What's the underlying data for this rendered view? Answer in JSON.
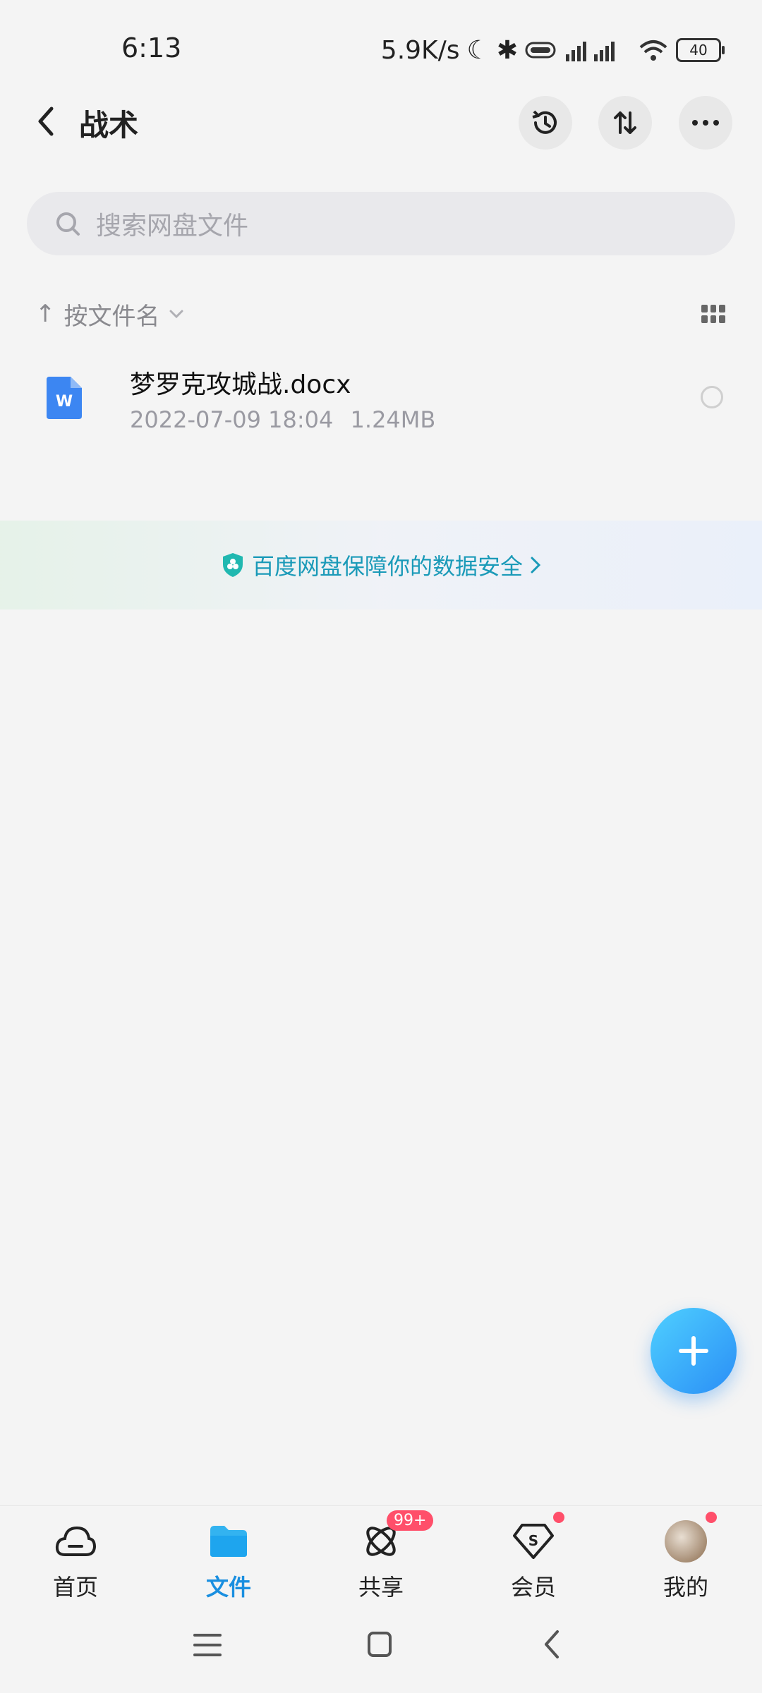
{
  "status_bar": {
    "time": "6:13",
    "speed": "5.9K/s",
    "battery": "40"
  },
  "header": {
    "title": "战术"
  },
  "search": {
    "placeholder": "搜索网盘文件"
  },
  "sort": {
    "label": "按文件名"
  },
  "files": [
    {
      "name": "梦罗克攻城战.docx",
      "date": "2022-07-09  18:04",
      "size": "1.24MB",
      "type": "word"
    }
  ],
  "banner": {
    "text": "百度网盘保障你的数据安全"
  },
  "bottom_nav": [
    {
      "label": "首页",
      "icon": "cloud-icon",
      "active": false
    },
    {
      "label": "文件",
      "icon": "folder-icon",
      "active": true
    },
    {
      "label": "共享",
      "icon": "share-atom-icon",
      "badge": "99+"
    },
    {
      "label": "会员",
      "icon": "vip-diamond-icon",
      "dot": true
    },
    {
      "label": "我的",
      "icon": "avatar",
      "dot": true
    }
  ],
  "colors": {
    "accent": "#1a8fe0",
    "badge": "#ff4f6a",
    "fab": "#2a8ef6"
  }
}
